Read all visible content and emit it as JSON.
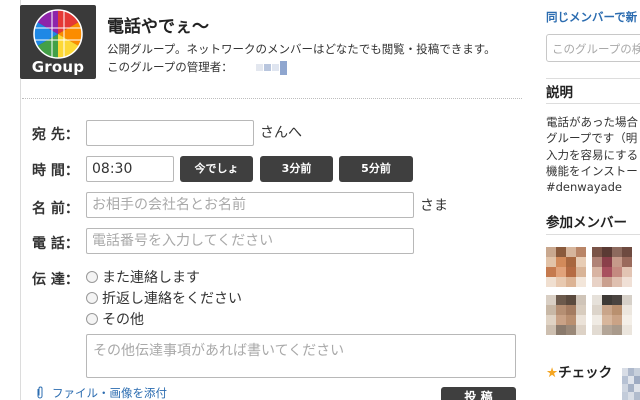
{
  "header": {
    "logo_text": "Group",
    "title": "電話やでぇ〜",
    "description": "公開グループ。ネットワークのメンバーはどなたでも閲覧・投稿できます。",
    "admin_label": "このグループの管理者："
  },
  "form": {
    "to": {
      "label": "宛 先：",
      "value": "",
      "suffix": "さんへ"
    },
    "time": {
      "label": "時 間：",
      "value": "08:30",
      "buttons": [
        "今でしょ",
        "3分前",
        "5分前"
      ]
    },
    "name": {
      "label": "名 前：",
      "placeholder": "お相手の会社名とお名前",
      "suffix": "さま"
    },
    "phone": {
      "label": "電 話：",
      "placeholder": "電話番号を入力してください"
    },
    "message": {
      "label": "伝 達：",
      "options": [
        "また連絡します",
        "折返し連絡をください",
        "その他"
      ],
      "memo_placeholder": "その他伝達事項があれば書いてください"
    },
    "attach_label": "ファイル・画像を添付",
    "post_label": "投 稿"
  },
  "sidebar": {
    "same_members_link": "同じメンバーで新",
    "search_placeholder": "このグループの検",
    "description_heading": "説明",
    "description_lines": [
      "電話があった場合",
      "グループです（明",
      "入力を容易にする",
      "機能をインストー",
      "#denwayade"
    ],
    "members_heading": "参加メンバー",
    "check_heading": "チェック",
    "check_star": "★"
  },
  "colors": {
    "accent_blue": "#2b6cb0",
    "dark_button": "#3f3f3f",
    "logo_bg": "#3a3a3a",
    "star": "#f5a623"
  },
  "icons": {
    "logo": "group-logo-icon",
    "radio": "radio-icon",
    "attach": "paperclip-icon",
    "star": "star-icon"
  }
}
